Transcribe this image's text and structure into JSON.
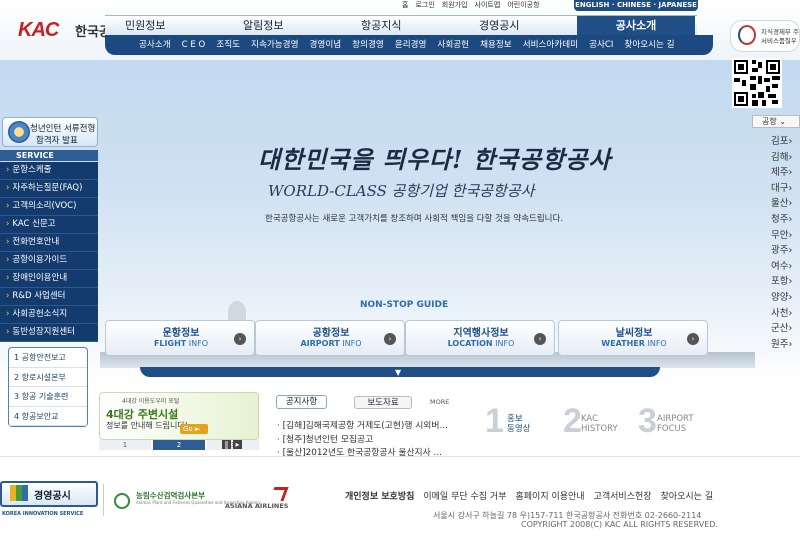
{
  "header": {
    "logo_text": "KAC",
    "logo_kr": "한국공항공사",
    "util_links": [
      "홈",
      "로그인",
      "회원가입",
      "사이트맵",
      "어린이공항"
    ],
    "lang_bar": "ENGLISH · CHINESE · JAPANESE",
    "top_nav": [
      {
        "label": "민원정보"
      },
      {
        "label": "알림정보"
      },
      {
        "label": "항공지식"
      },
      {
        "label": "경영공시"
      },
      {
        "label": "공사소개"
      }
    ],
    "sub_nav": [
      "공사소개",
      "C E O",
      "조직도",
      "지속가능경영",
      "경영이념",
      "창의경영",
      "윤리경영",
      "사회공헌",
      "채용정보",
      "서비스아카데미",
      "공사CI",
      "찾아오시는 길"
    ]
  },
  "right": {
    "badge_l1": "지식경제부 주",
    "badge_l2": "서비스품질우",
    "airport_label": "공항",
    "airports": [
      "김포",
      "김해",
      "제주",
      "대구",
      "울산",
      "청주",
      "무안",
      "광주",
      "여수",
      "포항",
      "양양",
      "사천",
      "군산",
      "원주"
    ]
  },
  "sidebar": {
    "intern_line1": "청년인턴 서류전형",
    "intern_line2": "합격자 발표",
    "service_header": "SERVICE",
    "service_items": [
      "운항스케줄",
      "자주하는질문(FAQ)",
      "고객의소리(VOC)",
      "KAC 신문고",
      "전화번호안내",
      "공항이용가이드",
      "장애인이용안내",
      "R&D 사업센터",
      "사회공헌소식지",
      "동반성장지원센터"
    ],
    "quick_items": [
      "1 공항안전보고",
      "2 항로시설본부",
      "3 항공 기술훈련",
      "4 항공보안교"
    ]
  },
  "hero": {
    "slogan": "대한민국을 띄우다! 한국공항공사",
    "worldclass": "WORLD-CLASS 공항기업 한국공항공사",
    "tagline": "한국공항공사는 새로운 고객가치를 창조하며 사회적 책임을 다할 것을 약속드립니다."
  },
  "guide": {
    "title": "NON-STOP GUIDE",
    "items": [
      {
        "kr": "운항정보",
        "en_b": "FLIGHT",
        "en": "INFO"
      },
      {
        "kr": "공항정보",
        "en_b": "AIRPORT",
        "en": "INFO"
      },
      {
        "kr": "지역행사정보",
        "en_b": "LOCATION",
        "en": "INFO"
      },
      {
        "kr": "날씨정보",
        "en_b": "WEATHER",
        "en": "INFO"
      }
    ]
  },
  "promo": {
    "tag": "4대강 이용도우미 포털",
    "line1": "4대강 주변시설",
    "line2": "정보를 안내해 드립니다!",
    "go": "Go ►",
    "pages": [
      "1",
      "2",
      "3"
    ],
    "active_page": 2
  },
  "news": {
    "tab_notice": "공지사항",
    "tab_press": "보도자료",
    "more": "MORE",
    "items": [
      "[김해]김해국제공항 거제도(고현)행 시외버...",
      "[청주]청년인턴 모집공고",
      "[울산]2012년도 한국공항공사 울산지사 ..."
    ]
  },
  "history": [
    {
      "num": "1",
      "label": "홍보\n동영상"
    },
    {
      "num": "2",
      "label": "KAC\nHISTORY"
    },
    {
      "num": "3",
      "label": "AIRPORT\nFOCUS"
    }
  ],
  "footer": {
    "biz_label": "경영공시",
    "kis_logo": "KOREA INNOVATION SERVICE",
    "agri_logo": "농림수산검역검사본부",
    "agri_sub": "Animal, Plant and Fisheries Quarantine and Inspection Agency",
    "asiana_logo": "ASIANA AIRLINES",
    "links": [
      "개인정보 보호방침",
      "이메일 무단 수집 거부",
      "홈페이지 이용안내",
      "고객서비스헌장",
      "찾아오시는 길"
    ],
    "address": "서울시 강서구 하늘길 78 우)157-711 한국공항공사 전화번호 02-2660-2114",
    "copyright": "COPYRIGHT 2008(C) KAC ALL RIGHTS RESERVED."
  }
}
